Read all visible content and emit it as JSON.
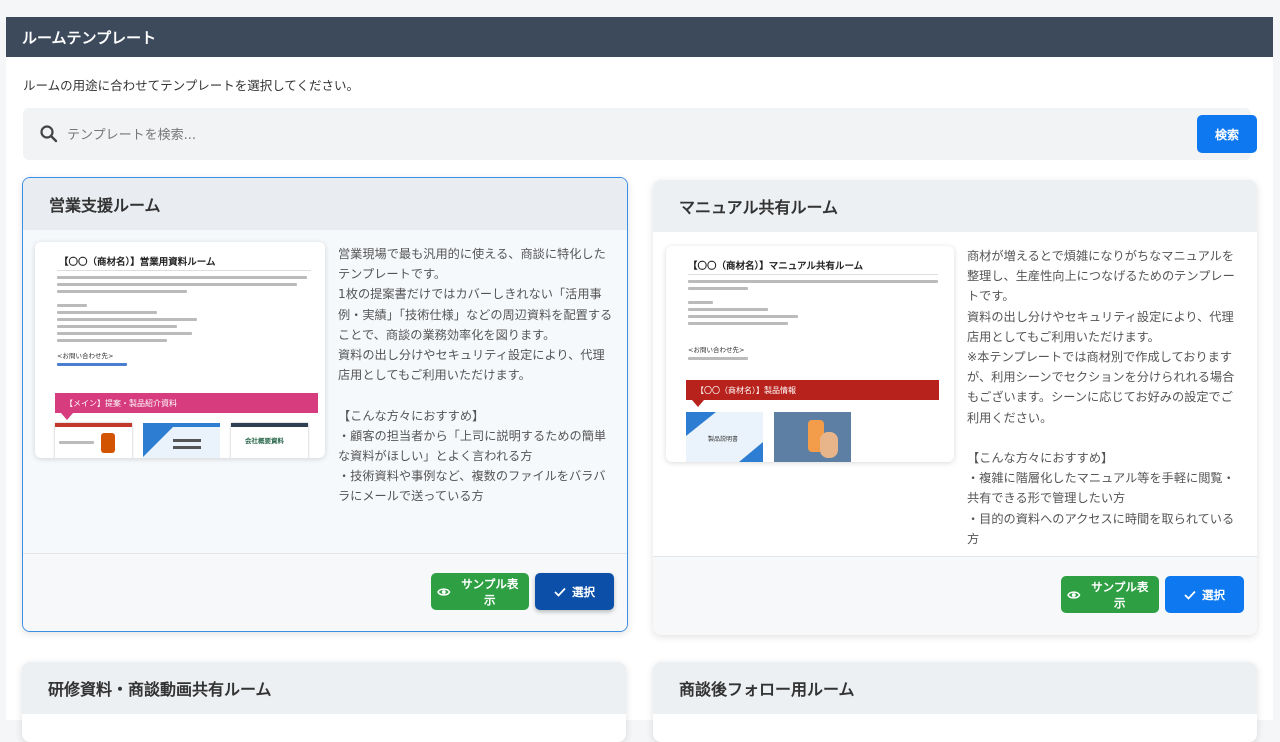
{
  "panel": {
    "title": "ルームテンプレート",
    "intro": "ルームの用途に合わせてテンプレートを選択してください。"
  },
  "search": {
    "placeholder": "テンプレートを検索...",
    "button_label": "検索"
  },
  "colors": {
    "header_bg": "#3c4a5c",
    "primary": "#0d78ef",
    "selected_primary": "#0b4fa8",
    "success": "#2ea043",
    "sales_banner": "#d63c7e",
    "manual_banner": "#b8221c"
  },
  "cards": [
    {
      "title": "営業支援ルーム",
      "selected": true,
      "thumb_title": "【〇〇（商材名）】営業用資料ルーム",
      "thumb_contact": "<お問い合わせ先>",
      "thumb_banner": "【メイン】提案・製品紹介資料",
      "thumb_tile1": "会社概要資料",
      "description": "営業現場で最も汎用的に使える、商談に特化したテンプレートです。\n1枚の提案書だけではカバーしきれない「活用事例・実績」「技術仕様」などの周辺資料を配置することで、商談の業務効率化を図ります。\n資料の出し分けやセキュリティ設定により、代理店用としてもご利用いただけます。\n\n【こんな方々におすすめ】\n・顧客の担当者から「上司に説明するための簡単な資料がほしい」とよく言われる方\n・技術資料や事例など、複数のファイルをバラバラにメールで送っている方",
      "sample_label": "サンプル表示",
      "select_label": "選択"
    },
    {
      "title": "マニュアル共有ルーム",
      "selected": false,
      "thumb_title": "【〇〇（商材名）】マニュアル共有ルーム",
      "thumb_contact": "<お問い合わせ先>",
      "thumb_banner": "【〇〇（商材名）】製品情報",
      "thumb_tile1": "製品説明書",
      "description": "商材が増えるとで煩雑になりがちなマニュアルを整理し、生産性向上につなげるためのテンプレートです。\n資料の出し分けやセキュリティ設定により、代理店用としてもご利用いただけます。\n※本テンプレートでは商材別で作成しておりますが、利用シーンでセクションを分けられれる場合もございます。シーンに応じてお好みの設定でご利用ください。\n\n【こんな方々におすすめ】\n・複雑に階層化したマニュアル等を手軽に閲覧・共有できる形で管理したい方\n・目的の資料へのアクセスに時間を取られている方",
      "sample_label": "サンプル表示",
      "select_label": "選択"
    },
    {
      "title": "研修資料・商談動画共有ルーム"
    },
    {
      "title": "商談後フォロー用ルーム"
    }
  ]
}
